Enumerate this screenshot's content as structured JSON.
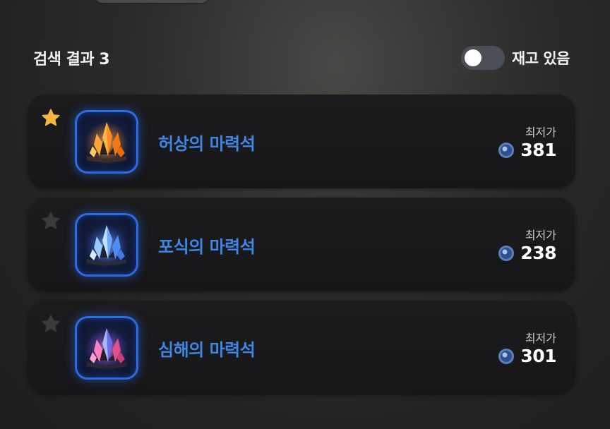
{
  "header": {
    "results_label": "검색 결과 3",
    "stock_toggle_label": "재고 있음",
    "stock_toggle_on": false
  },
  "items": [
    {
      "name": "허상의 마력석",
      "price_label": "최저가",
      "price": "381",
      "favorite": true,
      "icon": "orange-crystal-icon",
      "accent": "#f5a623"
    },
    {
      "name": "포식의 마력석",
      "price_label": "최저가",
      "price": "238",
      "favorite": false,
      "icon": "blue-crystal-icon",
      "accent": "#7fb6ff"
    },
    {
      "name": "심해의 마력석",
      "price_label": "최저가",
      "price": "301",
      "favorite": false,
      "icon": "pink-crystal-icon",
      "accent": "#ff6fa8"
    }
  ],
  "colors": {
    "item_name": "#3d86e6",
    "icon_border": "#2f6be0",
    "star_active": "#f4b63f",
    "star_inactive": "#3a3a3d"
  }
}
